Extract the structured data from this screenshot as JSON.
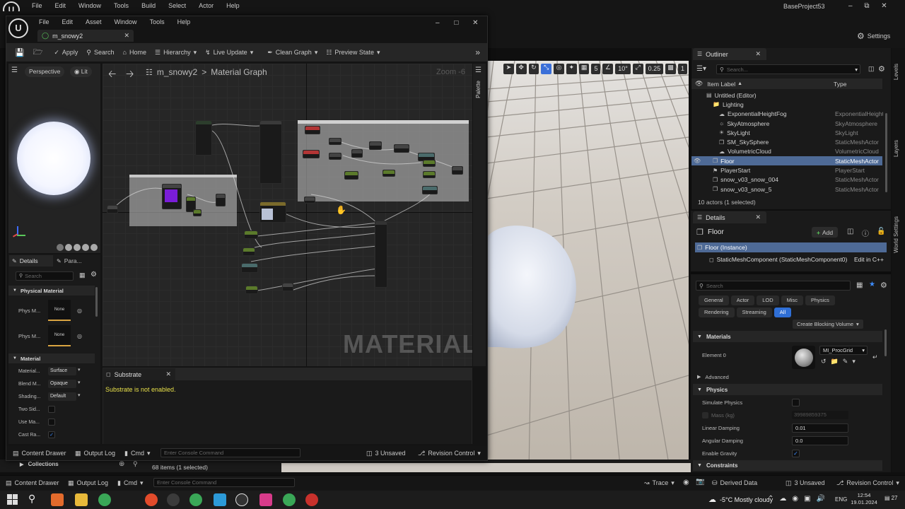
{
  "main_window": {
    "menu": [
      "File",
      "Edit",
      "Window",
      "Tools",
      "Build",
      "Select",
      "Actor",
      "Help"
    ],
    "project_name": "BaseProject53",
    "settings_label": "Settings"
  },
  "material_editor": {
    "menu": [
      "File",
      "Edit",
      "Asset",
      "Window",
      "Tools",
      "Help"
    ],
    "tab_title": "m_snowy2",
    "toolbar": {
      "apply": "Apply",
      "search": "Search",
      "home": "Home",
      "hierarchy": "Hierarchy",
      "live_update": "Live Update",
      "clean_graph": "Clean Graph",
      "preview_state": "Preview State"
    },
    "viewport": {
      "perspective": "Perspective",
      "lit": "Lit"
    },
    "graph": {
      "breadcrumb_asset": "m_snowy2",
      "breadcrumb_sep": ">",
      "breadcrumb_graph": "Material Graph",
      "zoom": "Zoom -6",
      "watermark": "MATERIAL",
      "palette": "Palette"
    },
    "details": {
      "tab_details": "Details",
      "tab_params": "Para...",
      "search_placeholder": "Search",
      "section_physical": "Physical Material",
      "phys_rows": [
        {
          "label": "Phys M...",
          "value": "None"
        },
        {
          "label": "Phys M...",
          "value": "None"
        }
      ],
      "section_material": "Material",
      "material_rows": [
        {
          "label": "Material...",
          "value": "Surface"
        },
        {
          "label": "Blend M...",
          "value": "Opaque"
        },
        {
          "label": "Shading...",
          "value": "Default"
        }
      ],
      "check_rows": [
        {
          "label": "Two Sid...",
          "checked": false
        },
        {
          "label": "Use Ma...",
          "checked": false
        },
        {
          "label": "Cast Ra...",
          "checked": true
        }
      ]
    },
    "substrate": {
      "tab": "Substrate",
      "message": "Substrate is not enabled."
    },
    "bottom": {
      "content_drawer": "Content Drawer",
      "output_log": "Output Log",
      "cmd": "Cmd",
      "console_placeholder": "Enter Console Command",
      "unsaved": "3 Unsaved",
      "revision": "Revision Control"
    }
  },
  "viewport_toolbar": {
    "grid_snap": "5",
    "rotation_snap": "10°",
    "scale_snap": "0.25",
    "camera_speed": "1"
  },
  "outliner": {
    "tab": "Outliner",
    "search_placeholder": "Search...",
    "col_label": "Item Label",
    "col_type": "Type",
    "rows": [
      {
        "label": "Untitled (Editor)",
        "type": "",
        "indent": 2,
        "icon": "world-icon"
      },
      {
        "label": "Lighting",
        "type": "",
        "indent": 3,
        "icon": "folder-icon"
      },
      {
        "label": "ExponentialHeightFog",
        "type": "ExponentialHeight",
        "indent": 4,
        "icon": "fog-icon"
      },
      {
        "label": "SkyAtmosphere",
        "type": "SkyAtmosphere",
        "indent": 4,
        "icon": "sky-icon"
      },
      {
        "label": "SkyLight",
        "type": "SkyLight",
        "indent": 4,
        "icon": "light-icon"
      },
      {
        "label": "SM_SkySphere",
        "type": "StaticMeshActor",
        "indent": 4,
        "icon": "mesh-icon"
      },
      {
        "label": "VolumetricCloud",
        "type": "VolumetricCloud",
        "indent": 4,
        "icon": "cloud-icon"
      },
      {
        "label": "Floor",
        "type": "StaticMeshActor",
        "indent": 3,
        "icon": "mesh-icon",
        "selected": true
      },
      {
        "label": "PlayerStart",
        "type": "PlayerStart",
        "indent": 3,
        "icon": "player-icon"
      },
      {
        "label": "snow_v03_snow_004",
        "type": "StaticMeshActor",
        "indent": 3,
        "icon": "mesh-icon"
      },
      {
        "label": "snow_v03_snow_5",
        "type": "StaticMeshActor",
        "indent": 3,
        "icon": "mesh-icon"
      }
    ],
    "footer": "10 actors (1 selected)"
  },
  "right_tabs": {
    "levels": "Levels",
    "layers": "Layers",
    "world_settings": "World Settings"
  },
  "details": {
    "tab": "Details",
    "actor_name": "Floor",
    "add_label": "Add",
    "instance": "Floor (Instance)",
    "component": "StaticMeshComponent (StaticMeshComponent0)",
    "edit_cpp": "Edit in C++",
    "search_placeholder": "Search",
    "filters": [
      "General",
      "Actor",
      "LOD",
      "Misc",
      "Physics",
      "Rendering",
      "Streaming",
      "All"
    ],
    "blocking_volume": "Create Blocking Volume",
    "section_materials": "Materials",
    "element0_label": "Element 0",
    "element0_value": "MI_ProcGrid",
    "advanced": "Advanced",
    "section_physics": "Physics",
    "simulate_physics": "Simulate Physics",
    "mass_label": "Mass (kg)",
    "mass_value": "39989859375",
    "linear_damping_label": "Linear Damping",
    "linear_damping_value": "0.01",
    "angular_damping_label": "Angular Damping",
    "angular_damping_value": "0.0",
    "enable_gravity": "Enable Gravity",
    "constraints": "Constraints"
  },
  "content_browser": {
    "collections": "Collections",
    "items": "68 items (1 selected)"
  },
  "status_bar": {
    "content_drawer": "Content Drawer",
    "output_log": "Output Log",
    "cmd": "Cmd",
    "console_placeholder": "Enter Console Command",
    "trace": "Trace",
    "derived_data": "Derived Data",
    "unsaved": "3 Unsaved",
    "revision": "Revision Control"
  },
  "taskbar": {
    "weather": "-5°C  Mostly cloudy",
    "language": "ENG",
    "time": "12:54",
    "date": "19.01.2024",
    "notifications": "27"
  }
}
